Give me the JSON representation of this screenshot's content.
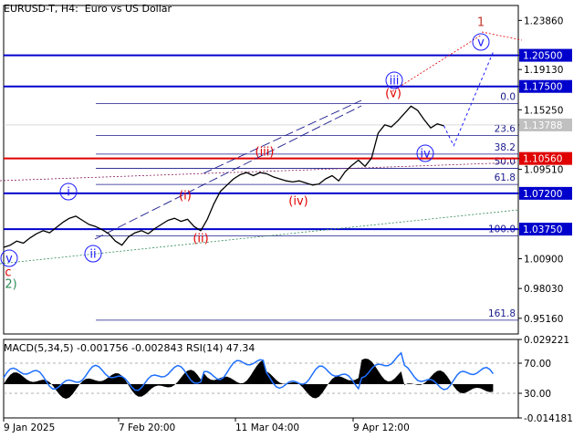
{
  "chart_data": [
    {
      "type": "line",
      "title": "EURUSD-T, H4:  Euro vs US Dollar",
      "price_scale": [
        "1.23860",
        "1.20500",
        "1.19130",
        "1.17500",
        "1.15250",
        "1.13788",
        "1.10560",
        "1.09510",
        "1.07200",
        "1.03750",
        "1.00900",
        "0.98030",
        "0.95160"
      ],
      "ylim": [
        0.9365,
        1.253
      ],
      "time_labels": [
        "9 Jan 2025",
        "7 Feb 20:00",
        "11 Mar 04:00",
        "9 Apr 12:00"
      ],
      "key_levels": [
        {
          "value": 1.205,
          "label": "1.20500",
          "color": "#0000cd"
        },
        {
          "value": 1.175,
          "label": "1.17500",
          "color": "#0000cd"
        },
        {
          "value": 1.1056,
          "label": "1.10560",
          "color": "#e00000"
        },
        {
          "value": 1.072,
          "label": "1.07200",
          "color": "#0000cd"
        },
        {
          "value": 1.0375,
          "label": "1.03750",
          "color": "#0000cd"
        }
      ],
      "current_price": {
        "value": 1.13788,
        "label": "1.13788"
      },
      "fibonacci": [
        {
          "label": "0.0",
          "value": 1.1585
        },
        {
          "label": "23.6",
          "value": 1.1278
        },
        {
          "label": "38.2",
          "value": 1.1098
        },
        {
          "label": "50.0",
          "value": 1.096
        },
        {
          "label": "61.8",
          "value": 1.0806
        },
        {
          "label": "100.0",
          "value": 1.031
        },
        {
          "label": "161.8",
          "value": 0.9498
        }
      ],
      "wave_labels": [
        {
          "text": "1",
          "color": "#c0392b"
        },
        {
          "text": "v",
          "color": "#1a1aff",
          "circled": true
        },
        {
          "text": "iii",
          "color": "#1a1aff",
          "circled": true
        },
        {
          "text": "(v)",
          "color": "#e00000"
        },
        {
          "text": "(iii)",
          "color": "#e00000"
        },
        {
          "text": "iv",
          "color": "#1a1aff",
          "circled": true
        },
        {
          "text": "(iv)",
          "color": "#e00000"
        },
        {
          "text": "(i)",
          "color": "#e00000"
        },
        {
          "text": "(ii)",
          "color": "#e00000"
        },
        {
          "text": "i",
          "color": "#1a1aff",
          "circled": true
        },
        {
          "text": "ii",
          "color": "#1a1aff",
          "circled": true
        },
        {
          "text": "v",
          "color": "#1a1aff",
          "circled": true
        },
        {
          "text": "c",
          "color": "#e00000"
        },
        {
          "text": "2)",
          "color": "#2e8b57"
        }
      ],
      "series": [
        {
          "name": "EURUSD-T",
          "points": [
            [
              0,
              1.02
            ],
            [
              2,
              1.022
            ],
            [
              4,
              1.026
            ],
            [
              6,
              1.024
            ],
            [
              8,
              1.029
            ],
            [
              10,
              1.033
            ],
            [
              12,
              1.036
            ],
            [
              14,
              1.034
            ],
            [
              16,
              1.039
            ],
            [
              18,
              1.044
            ],
            [
              20,
              1.048
            ],
            [
              22,
              1.05
            ],
            [
              24,
              1.046
            ],
            [
              26,
              1.042
            ],
            [
              28,
              1.04
            ],
            [
              30,
              1.037
            ],
            [
              32,
              1.033
            ],
            [
              34,
              1.026
            ],
            [
              36,
              1.022
            ],
            [
              38,
              1.03
            ],
            [
              40,
              1.034
            ],
            [
              42,
              1.036
            ],
            [
              44,
              1.033
            ],
            [
              46,
              1.038
            ],
            [
              48,
              1.042
            ],
            [
              50,
              1.046
            ],
            [
              52,
              1.048
            ],
            [
              54,
              1.045
            ],
            [
              56,
              1.047
            ],
            [
              58,
              1.04
            ],
            [
              60,
              1.036
            ],
            [
              62,
              1.047
            ],
            [
              64,
              1.062
            ],
            [
              66,
              1.074
            ],
            [
              68,
              1.08
            ],
            [
              70,
              1.086
            ],
            [
              72,
              1.09
            ],
            [
              74,
              1.092
            ],
            [
              76,
              1.089
            ],
            [
              78,
              1.092
            ],
            [
              80,
              1.091
            ],
            [
              82,
              1.088
            ],
            [
              84,
              1.086
            ],
            [
              86,
              1.084
            ],
            [
              88,
              1.083
            ],
            [
              90,
              1.084
            ],
            [
              92,
              1.082
            ],
            [
              94,
              1.08
            ],
            [
              96,
              1.081
            ],
            [
              98,
              1.086
            ],
            [
              100,
              1.089
            ],
            [
              102,
              1.084
            ],
            [
              104,
              1.093
            ],
            [
              106,
              1.099
            ],
            [
              108,
              1.104
            ],
            [
              110,
              1.098
            ],
            [
              112,
              1.106
            ],
            [
              114,
              1.13
            ],
            [
              116,
              1.138
            ],
            [
              118,
              1.136
            ],
            [
              120,
              1.142
            ],
            [
              122,
              1.149
            ],
            [
              124,
              1.156
            ],
            [
              126,
              1.152
            ],
            [
              128,
              1.143
            ],
            [
              130,
              1.135
            ],
            [
              132,
              1.139
            ],
            [
              134,
              1.137
            ]
          ]
        },
        {
          "name": "projection",
          "points": [
            [
              134,
              1.137
            ],
            [
              137,
              1.118
            ],
            [
              149,
              1.208
            ]
          ]
        }
      ]
    },
    {
      "type": "line",
      "title": "MACD(5,34,5) -0.001756 -0.002843 RSI(14) 47.34",
      "tick_labels": [
        "0.029221",
        "70.00",
        "30.00",
        "-0.014181"
      ],
      "ylim": [
        -0.014181,
        0.029221
      ]
    }
  ]
}
